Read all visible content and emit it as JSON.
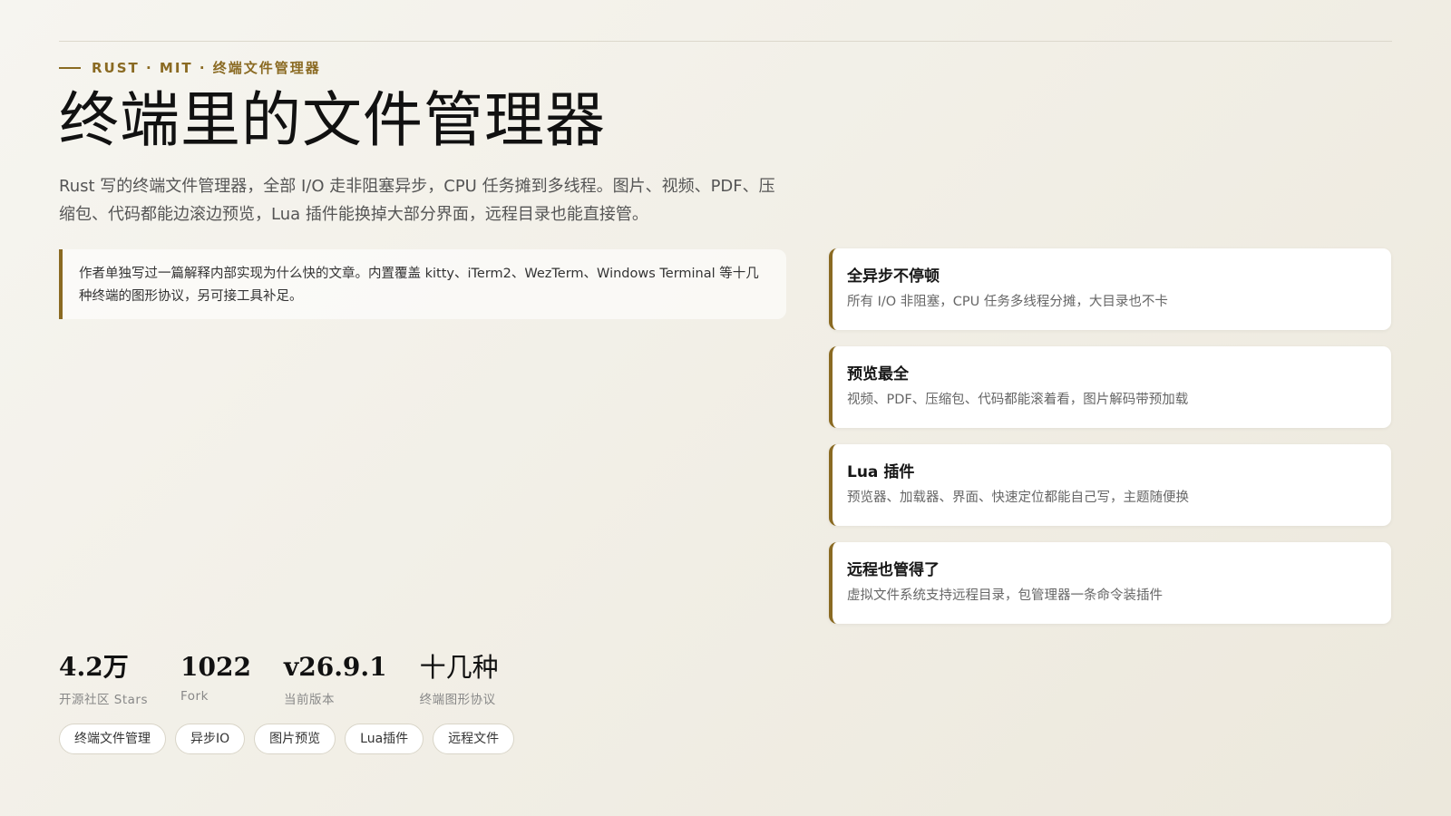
{
  "header": {
    "eyebrow": "RUST · MIT · 终端文件管理器",
    "title": "终端里的文件管理器",
    "lede": "Rust 写的终端文件管理器，全部 I/O 走非阻塞异步，CPU 任务摊到多线程。图片、视频、PDF、压缩包、代码都能边滚边预览，Lua 插件能换掉大部分界面，远程目录也能直接管。"
  },
  "note": {
    "text": "作者单独写过一篇解释内部实现为什么快的文章。内置覆盖 kitty、iTerm2、WezTerm、Windows Terminal 等十几种终端的图形协议，另可接工具补足。"
  },
  "features": [
    {
      "title": "全异步不停顿",
      "desc": "所有 I/O 非阻塞，CPU 任务多线程分摊，大目录也不卡"
    },
    {
      "title": "预览最全",
      "desc": "视频、PDF、压缩包、代码都能滚着看，图片解码带预加载"
    },
    {
      "title": "Lua 插件",
      "desc": "预览器、加载器、界面、快速定位都能自己写，主题随便换"
    },
    {
      "title": "远程也管得了",
      "desc": "虚拟文件系统支持远程目录，包管理器一条命令装插件"
    }
  ],
  "stats": [
    {
      "value": "4.2万",
      "label": "开源社区 Stars"
    },
    {
      "value": "1022",
      "label": "Fork"
    },
    {
      "value": "v26.9.1",
      "label": "当前版本"
    },
    {
      "value": "十几种",
      "label": "终端图形协议"
    }
  ],
  "tags": [
    "终端文件管理",
    "异步IO",
    "图片预览",
    "Lua插件",
    "远程文件"
  ],
  "colors": {
    "accent": "#8a6a22",
    "background": "#f3f1ea",
    "card": "#ffffff"
  }
}
